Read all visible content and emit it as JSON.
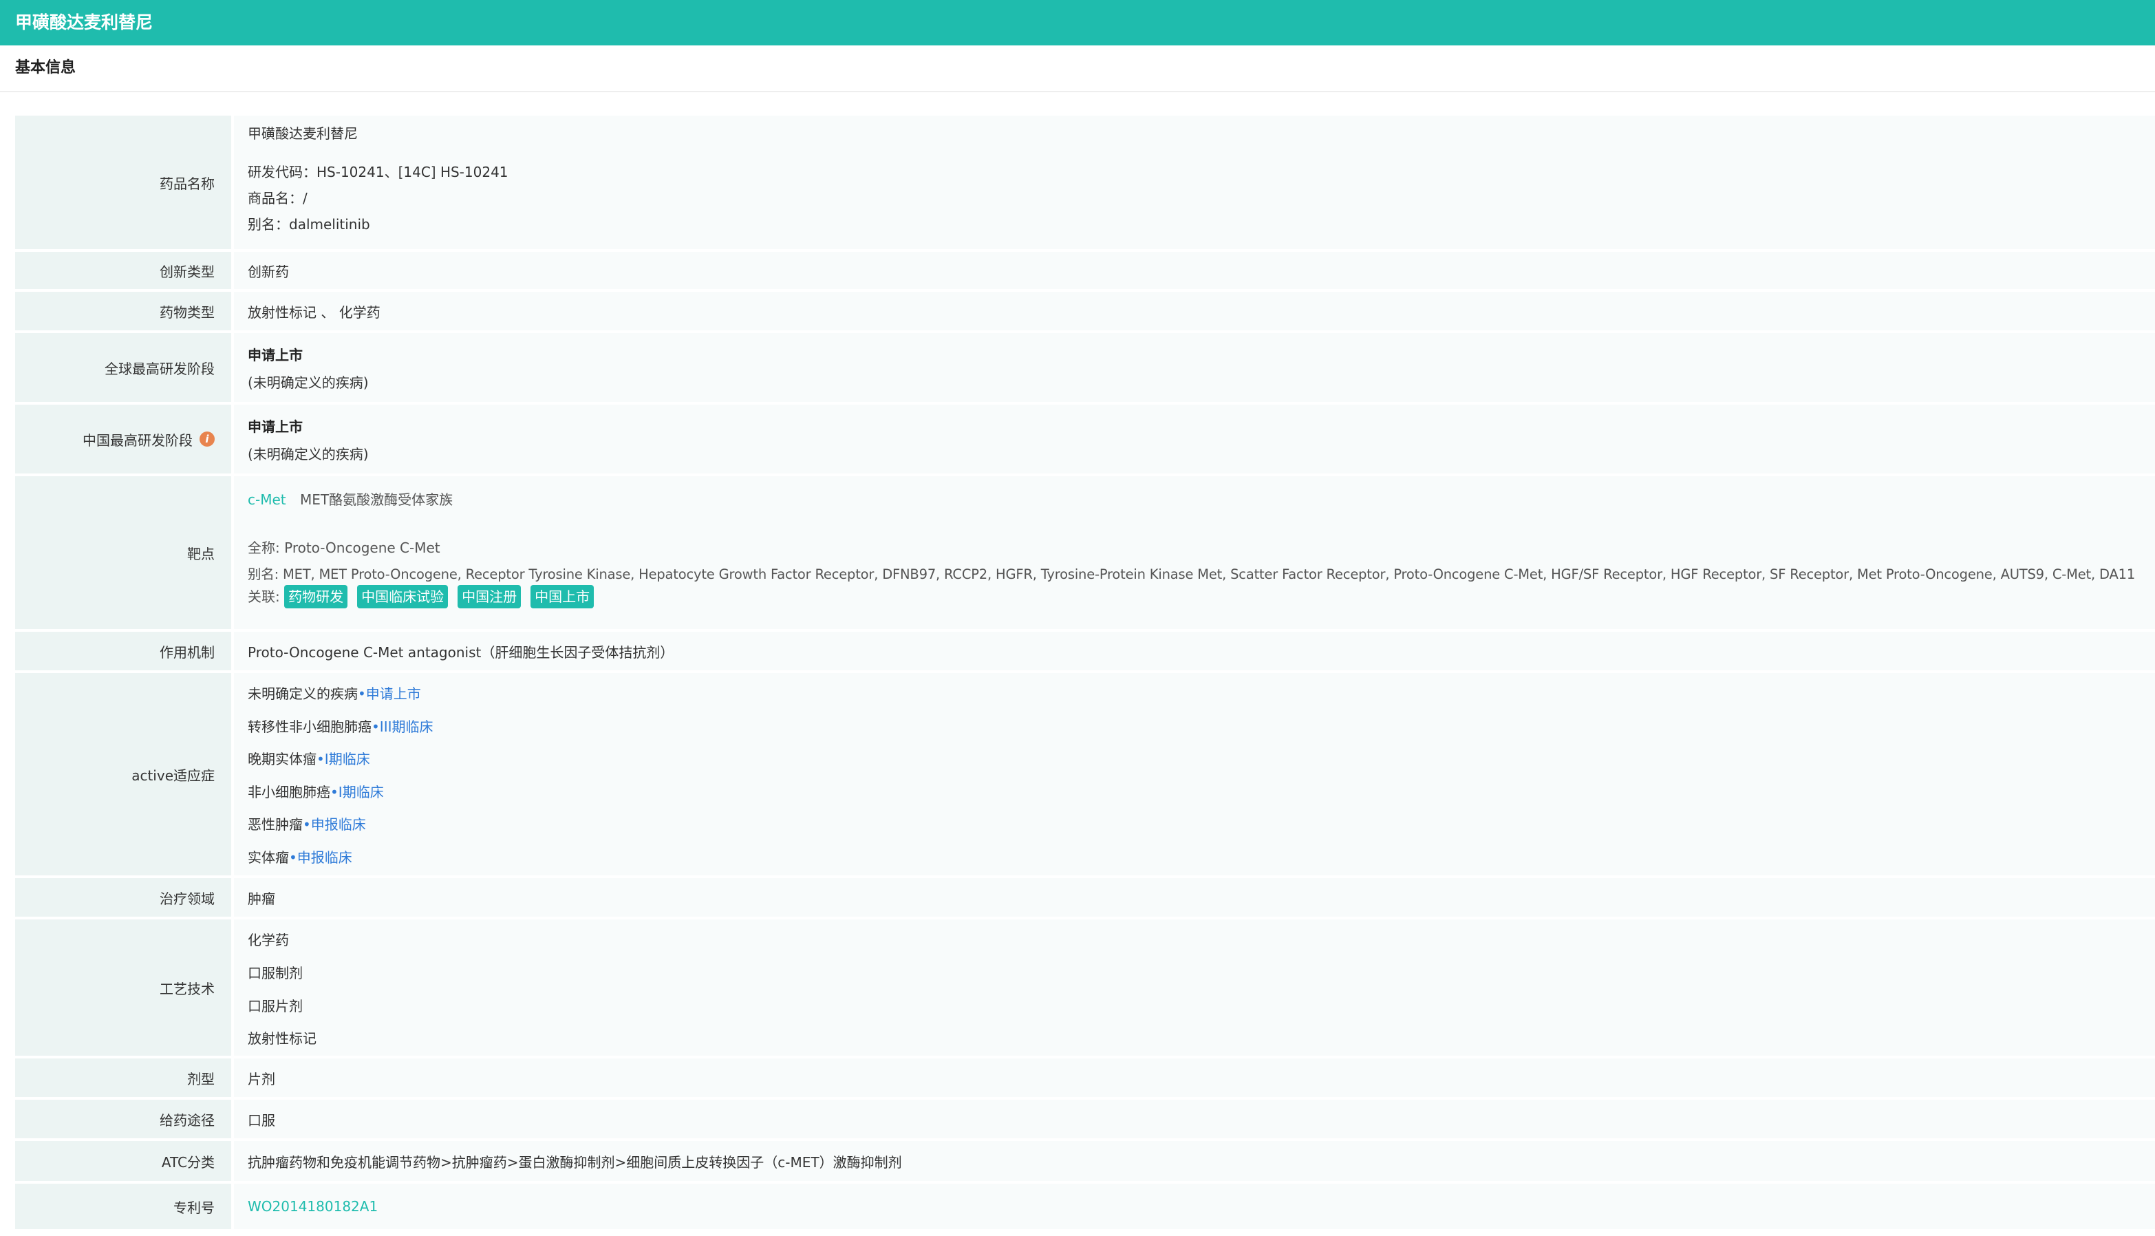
{
  "window": {
    "title": "甲磺酸达麦利替尼"
  },
  "section": {
    "title": "基本信息"
  },
  "rows": {
    "drug_name": {
      "label": "药品名称",
      "name": "甲磺酸达麦利替尼",
      "code": "研发代码：HS-10241、[14C] HS-10241",
      "trade": "商品名：/",
      "alias": "别名：dalmelitinib"
    },
    "innovation": {
      "label": "创新类型",
      "value": "创新药"
    },
    "drug_type": {
      "label": "药物类型",
      "value": "放射性标记 、 化学药"
    },
    "global_stage": {
      "label": "全球最高研发阶段",
      "stage": "申请上市",
      "note": "(未明确定义的疾病)"
    },
    "china_stage": {
      "label": "中国最高研发阶段",
      "info_icon": "i",
      "stage": "申请上市",
      "note": "(未明确定义的疾病)"
    },
    "target": {
      "label": "靶点",
      "target_link": "c-Met",
      "target_family": "MET酪氨酸激酶受体家族",
      "fullname_label": "全称:",
      "fullname": "Proto-Oncogene C-Met",
      "alias_label": "别名:",
      "alias": "MET, MET Proto-Oncogene, Receptor Tyrosine Kinase, Hepatocyte Growth Factor Receptor, DFNB97, RCCP2, HGFR, Tyrosine-Protein Kinase Met, Scatter Factor Receptor, Proto-Oncogene C-Met, HGF/SF Receptor, HGF Receptor, SF Receptor, Met Proto-Oncogene, AUTS9, C-Met, DA11",
      "related_label": "关联:",
      "tags": [
        "药物研发",
        "中国临床试验",
        "中国注册",
        "中国上市"
      ]
    },
    "mechanism": {
      "label": "作用机制",
      "value": "Proto-Oncogene C-Met antagonist（肝细胞生长因子受体拮抗剂）"
    },
    "indications": {
      "label": "active适应症",
      "items": [
        {
          "disease": "未明确定义的疾病",
          "stage": "申请上市"
        },
        {
          "disease": "转移性非小细胞肺癌",
          "stage": "III期临床"
        },
        {
          "disease": "晚期实体瘤",
          "stage": "Ⅰ期临床"
        },
        {
          "disease": "非小细胞肺癌",
          "stage": "Ⅰ期临床"
        },
        {
          "disease": "恶性肿瘤",
          "stage": "申报临床"
        },
        {
          "disease": "实体瘤",
          "stage": "申报临床"
        }
      ]
    },
    "therapy_area": {
      "label": "治疗领域",
      "value": "肿瘤"
    },
    "technology": {
      "label": "工艺技术",
      "items": [
        "化学药",
        "口服制剂",
        "口服片剂",
        "放射性标记"
      ]
    },
    "dosage_form": {
      "label": "剂型",
      "value": "片剂"
    },
    "route": {
      "label": "给药途径",
      "value": "口服"
    },
    "atc": {
      "label": "ATC分类",
      "value": "抗肿瘤药物和免疫机能调节药物>抗肿瘤药>蛋白激酶抑制剂>细胞间质上皮转换因子（c-MET）激酶抑制剂"
    },
    "patent": {
      "label": "专利号",
      "value": "WO2014180182A1"
    }
  },
  "colors": {
    "header": "#1fbcad",
    "link_teal": "#1fbcad",
    "link_blue": "#2f7bd8",
    "label_bg": "#ecf4f3",
    "value_bg": "#f8fbfb",
    "info_icon": "#e8844e"
  }
}
